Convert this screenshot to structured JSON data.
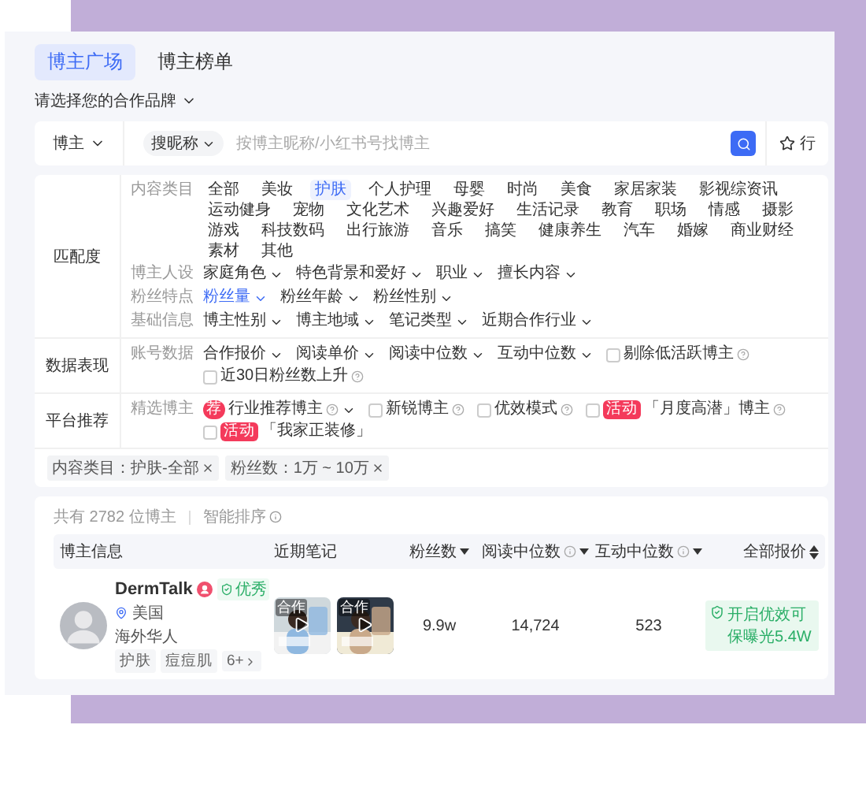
{
  "tabs": [
    {
      "label": "博主广场",
      "selected": true
    },
    {
      "label": "博主榜单",
      "selected": false
    }
  ],
  "brand_selector": {
    "label": "请选择您的合作品牌"
  },
  "search": {
    "scope": "博主",
    "mode": "搜昵称",
    "placeholder": "按博主昵称/小红书号找博主",
    "side_label": "行"
  },
  "filters": [
    {
      "label": "匹配度",
      "groups": [
        {
          "label": "内容类目",
          "options": [
            {
              "kind": "chip",
              "label": "全部",
              "selected": false
            },
            {
              "kind": "chip",
              "label": "美妆",
              "selected": false
            },
            {
              "kind": "chip",
              "label": "护肤",
              "selected": true
            },
            {
              "kind": "chip",
              "label": "个人护理",
              "selected": false
            },
            {
              "kind": "chip",
              "label": "母婴",
              "selected": false
            },
            {
              "kind": "chip",
              "label": "时尚",
              "selected": false
            },
            {
              "kind": "chip",
              "label": "美食",
              "selected": false
            },
            {
              "kind": "chip",
              "label": "家居家装",
              "selected": false
            },
            {
              "kind": "chip",
              "label": "影视综资讯",
              "selected": false
            },
            {
              "kind": "chip",
              "label": "运动健身",
              "selected": false
            },
            {
              "kind": "chip",
              "label": "宠物",
              "selected": false
            },
            {
              "kind": "chip",
              "label": "文化艺术",
              "selected": false
            },
            {
              "kind": "chip",
              "label": "兴趣爱好",
              "selected": false
            },
            {
              "kind": "chip",
              "label": "生活记录",
              "selected": false
            },
            {
              "kind": "chip",
              "label": "教育",
              "selected": false
            },
            {
              "kind": "chip",
              "label": "职场",
              "selected": false
            },
            {
              "kind": "chip",
              "label": "情感",
              "selected": false
            },
            {
              "kind": "chip",
              "label": "摄影",
              "selected": false
            },
            {
              "kind": "chip",
              "label": "游戏",
              "selected": false
            },
            {
              "kind": "chip",
              "label": "科技数码",
              "selected": false
            },
            {
              "kind": "chip",
              "label": "出行旅游",
              "selected": false
            },
            {
              "kind": "chip",
              "label": "音乐",
              "selected": false
            },
            {
              "kind": "chip",
              "label": "搞笑",
              "selected": false
            },
            {
              "kind": "chip",
              "label": "健康养生",
              "selected": false
            },
            {
              "kind": "chip",
              "label": "汽车",
              "selected": false
            },
            {
              "kind": "chip",
              "label": "婚嫁",
              "selected": false
            },
            {
              "kind": "chip",
              "label": "商业财经",
              "selected": false
            },
            {
              "kind": "chip",
              "label": "素材",
              "selected": false
            },
            {
              "kind": "chip",
              "label": "其他",
              "selected": false
            }
          ]
        },
        {
          "label": "博主人设",
          "options": [
            {
              "kind": "dropdown",
              "label": "家庭角色",
              "active": false
            },
            {
              "kind": "dropdown",
              "label": "特色背景和爱好",
              "active": false
            },
            {
              "kind": "dropdown",
              "label": "职业",
              "active": false
            },
            {
              "kind": "dropdown",
              "label": "擅长内容",
              "active": false
            }
          ]
        },
        {
          "label": "粉丝特点",
          "options": [
            {
              "kind": "dropdown",
              "label": "粉丝量",
              "active": true
            },
            {
              "kind": "dropdown",
              "label": "粉丝年龄",
              "active": false
            },
            {
              "kind": "dropdown",
              "label": "粉丝性别",
              "active": false
            }
          ]
        },
        {
          "label": "基础信息",
          "options": [
            {
              "kind": "dropdown",
              "label": "博主性别",
              "active": false
            },
            {
              "kind": "dropdown",
              "label": "博主地域",
              "active": false
            },
            {
              "kind": "dropdown",
              "label": "笔记类型",
              "active": false
            },
            {
              "kind": "dropdown",
              "label": "近期合作行业",
              "active": false
            }
          ]
        }
      ]
    },
    {
      "label": "数据表现",
      "groups": [
        {
          "label": "账号数据",
          "options": [
            {
              "kind": "dropdown",
              "label": "合作报价",
              "active": false
            },
            {
              "kind": "dropdown",
              "label": "阅读单价",
              "active": false
            },
            {
              "kind": "dropdown",
              "label": "阅读中位数",
              "active": false
            },
            {
              "kind": "dropdown",
              "label": "互动中位数",
              "active": false
            },
            {
              "kind": "checkbox",
              "label": "剔除低活跃博主",
              "checked": false,
              "help": true
            },
            {
              "kind": "checkbox",
              "label": "近30日粉丝数上升",
              "checked": false,
              "help": true
            }
          ]
        }
      ]
    },
    {
      "label": "平台推荐",
      "groups": [
        {
          "label": "精选博主",
          "options": [
            {
              "kind": "dropdown",
              "label": "行业推荐博主",
              "active": false,
              "badge": "荐",
              "help": true
            },
            {
              "kind": "checkbox",
              "label": "新锐博主",
              "checked": false,
              "help": true
            },
            {
              "kind": "checkbox",
              "label": "优效模式",
              "checked": false,
              "help": true
            },
            {
              "kind": "checkbox",
              "label": "「月度高潜」博主",
              "checked": false,
              "badge": "活动",
              "help": true
            },
            {
              "kind": "checkbox",
              "label": "「我家正装修」",
              "checked": false,
              "badge": "活动"
            }
          ]
        }
      ]
    }
  ],
  "applied_filters": [
    {
      "label": "内容类目：护肤-全部"
    },
    {
      "label": "粉丝数：1万 ~ 10万"
    }
  ],
  "results": {
    "summary": "共有 2782 位博主",
    "sort_label": "智能排序",
    "columns": [
      {
        "label": "博主信息",
        "sortable": false
      },
      {
        "label": "近期笔记",
        "sortable": false
      },
      {
        "label": "粉丝数",
        "sortable": true,
        "sorted": true
      },
      {
        "label": "阅读中位数",
        "info": true,
        "sortable": true,
        "sorted": true
      },
      {
        "label": "互动中位数",
        "info": true,
        "sortable": true,
        "sorted": true
      },
      {
        "label": "全部报价",
        "sortable": true,
        "sorted": false
      }
    ],
    "rows": [
      {
        "name": "DermTalk",
        "rating": "优秀",
        "location": "美国",
        "description": "海外华人",
        "tags": [
          "护肤",
          "痘痘肌"
        ],
        "more_tags": "6+",
        "notes": [
          {
            "label": "合作"
          },
          {
            "label": "合作"
          }
        ],
        "fans": "9.9w",
        "read_median": "14,724",
        "interaction_median": "523",
        "quote_note": "开启优效可保曝光5.4W"
      }
    ]
  }
}
